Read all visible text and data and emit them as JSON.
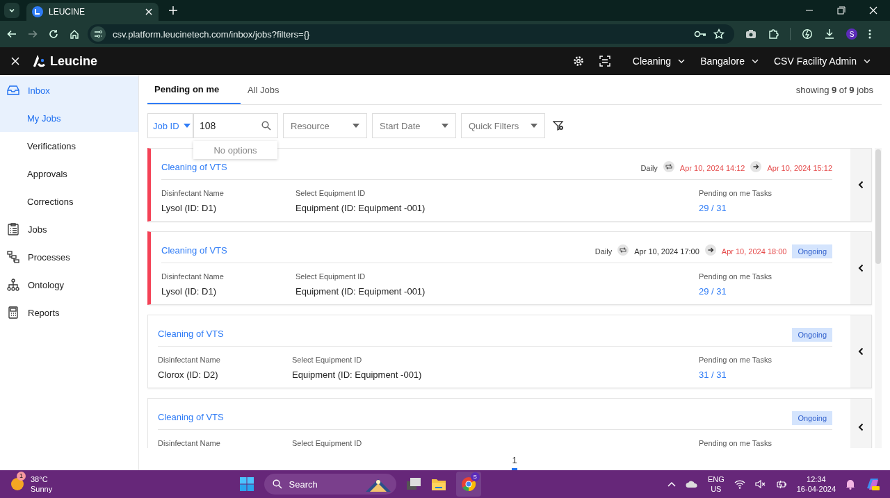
{
  "browser": {
    "tab": {
      "title": "LEUCINE"
    },
    "url": "csv.platform.leucinetech.com/inbox/jobs?filters={}",
    "profile": "S"
  },
  "header": {
    "logo": "Leucine",
    "menus": [
      {
        "label": "Cleaning"
      },
      {
        "label": "Bangalore"
      },
      {
        "label": "CSV Facility Admin"
      }
    ]
  },
  "sidebar": {
    "items": [
      {
        "label": "Inbox",
        "expanded": true,
        "children": [
          {
            "label": "My Jobs",
            "selected": true
          },
          {
            "label": "Verifications",
            "selected": false
          },
          {
            "label": "Approvals",
            "selected": false
          },
          {
            "label": "Corrections",
            "selected": false
          }
        ]
      },
      {
        "label": "Jobs",
        "selected": false
      },
      {
        "label": "Processes",
        "selected": false
      },
      {
        "label": "Ontology",
        "selected": false
      },
      {
        "label": "Reports",
        "selected": false
      }
    ]
  },
  "tabs": [
    {
      "label": "Pending on me",
      "selected": true
    },
    {
      "label": "All Jobs",
      "selected": false
    }
  ],
  "summary": "showing **9** of **9** jobs",
  "filters": {
    "field_select": "Job ID",
    "search": {
      "value": "108",
      "dropdown": "No options"
    },
    "dropdowns": [
      {
        "placeholder": "Resource"
      },
      {
        "placeholder": "Start Date"
      },
      {
        "placeholder": "Quick Filters"
      }
    ]
  },
  "cards": [
    {
      "title": "Cleaning of VTS",
      "overdue": true,
      "schedule": {
        "frequency": "Daily",
        "start": "Apr 10, 2024 14:12",
        "start_late": true,
        "end": "Apr 10, 2024 15:12",
        "end_late": true
      },
      "fields": [
        {
          "label": "Disinfectant Name",
          "value": "Lysol (ID: D1)"
        },
        {
          "label": "Select Equipment ID",
          "value": "Equipment (ID: Equipment -001)"
        }
      ],
      "tasks": {
        "label": "Pending on me Tasks",
        "value": "29 / 31"
      }
    },
    {
      "title": "Cleaning of VTS",
      "overdue": true,
      "status": "Ongoing",
      "schedule": {
        "frequency": "Daily",
        "start": "Apr 10, 2024 17:00",
        "start_late": false,
        "end": "Apr 10, 2024 18:00",
        "end_late": true
      },
      "fields": [
        {
          "label": "Disinfectant Name",
          "value": "Lysol (ID: D1)"
        },
        {
          "label": "Select Equipment ID",
          "value": "Equipment (ID: Equipment -001)"
        }
      ],
      "tasks": {
        "label": "Pending on me Tasks",
        "value": "29 / 31"
      }
    },
    {
      "title": "Cleaning of VTS",
      "overdue": false,
      "status": "Ongoing",
      "fields": [
        {
          "label": "Disinfectant Name",
          "value": "Clorox (ID: D2)"
        },
        {
          "label": "Select Equipment ID",
          "value": "Equipment (ID: Equipment -001)"
        }
      ],
      "tasks": {
        "label": "Pending on me Tasks",
        "value": "31 / 31"
      }
    },
    {
      "title": "Cleaning of VTS",
      "overdue": false,
      "status": "Ongoing",
      "fields": [
        {
          "label": "Disinfectant Name"
        },
        {
          "label": "Select Equipment ID"
        }
      ],
      "tasks": {
        "label": "Pending on me Tasks"
      }
    }
  ],
  "pagination": [
    {
      "label": "1",
      "selected": true
    }
  ],
  "taskbar": {
    "weather": {
      "temp": "38°C",
      "condition": "Sunny",
      "badge": "1"
    },
    "search": "Search",
    "chrome_badge": "S",
    "language": [
      "ENG",
      "US"
    ],
    "time": "12:34",
    "date": "16-04-2024"
  }
}
